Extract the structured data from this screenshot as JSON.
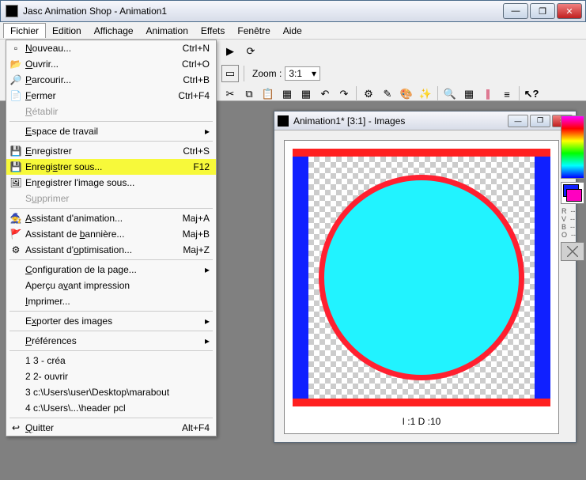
{
  "app": {
    "title": "Jasc Animation Shop - Animation1"
  },
  "winbtns": {
    "min": "—",
    "max": "❐",
    "close": "✕"
  },
  "menu": {
    "items": [
      "Fichier",
      "Edition",
      "Affichage",
      "Animation",
      "Effets",
      "Fenêtre",
      "Aide"
    ],
    "u": [
      "F",
      "E",
      "A",
      "n",
      "t",
      "n",
      "A"
    ]
  },
  "dropdown": [
    {
      "icon": "new-icon",
      "label": "Nouveau...",
      "u": "N",
      "sc": "Ctrl+N"
    },
    {
      "icon": "open-icon",
      "label": "Ouvrir...",
      "u": "O",
      "sc": "Ctrl+O"
    },
    {
      "icon": "browse-icon",
      "label": "Parcourir...",
      "u": "P",
      "sc": "Ctrl+B"
    },
    {
      "icon": "close-icon",
      "label": "Fermer",
      "u": "F",
      "sc": "Ctrl+F4"
    },
    {
      "label": "Rétablir",
      "u": "R",
      "disabled": true
    },
    {
      "sep": true
    },
    {
      "label": "Espace de travail",
      "u": "E",
      "sub": true
    },
    {
      "sep": true
    },
    {
      "icon": "save-icon",
      "label": "Enregistrer",
      "u": "E",
      "sc": "Ctrl+S"
    },
    {
      "icon": "saveas-icon",
      "label": "Enregistrer sous...",
      "u": "s",
      "sc": "F12",
      "hl": true
    },
    {
      "icon": "saveframe-icon",
      "label": "Enregistrer l'image sous...",
      "u": "r"
    },
    {
      "label": "Supprimer",
      "u": "u",
      "disabled": true
    },
    {
      "sep": true
    },
    {
      "icon": "wizard-icon",
      "label": "Assistant d'animation...",
      "u": "A",
      "sc": "Maj+A"
    },
    {
      "icon": "banner-icon",
      "label": "Assistant de bannière...",
      "u": "b",
      "sc": "Maj+B"
    },
    {
      "icon": "opt-icon",
      "label": "Assistant d'optimisation...",
      "u": "o",
      "sc": "Maj+Z"
    },
    {
      "sep": true
    },
    {
      "label": "Configuration de la page...",
      "u": "C",
      "sub": true
    },
    {
      "label": "Aperçu avant impression",
      "u": "v"
    },
    {
      "label": "Imprimer...",
      "u": "I"
    },
    {
      "sep": true
    },
    {
      "label": "Exporter des images",
      "u": "x",
      "sub": true
    },
    {
      "sep": true
    },
    {
      "label": "Préférences",
      "u": "P",
      "sub": true
    },
    {
      "sep": true
    },
    {
      "label": "1 3 - créa"
    },
    {
      "label": "2 2- ouvrir"
    },
    {
      "label": "3 c:\\Users\\user\\Desktop\\marabout"
    },
    {
      "label": "4 c:\\Users\\...\\header pcl"
    },
    {
      "sep": true
    },
    {
      "icon": "quit-icon",
      "label": "Quitter",
      "u": "Q",
      "sc": "Alt+F4"
    }
  ],
  "toolbar": {
    "zoom_label": "Zoom :",
    "zoom_value": "3:1"
  },
  "child": {
    "title": "Animation1* [3:1] - Images",
    "status": "I :1   D :10"
  },
  "rvb": "R  --\nV  --\nB  --\nO  --",
  "chart_data": {
    "type": "table",
    "note": "Not a chart image; canvas shows a cyan circle with red outline on transparent bg inside blue/red frame."
  }
}
